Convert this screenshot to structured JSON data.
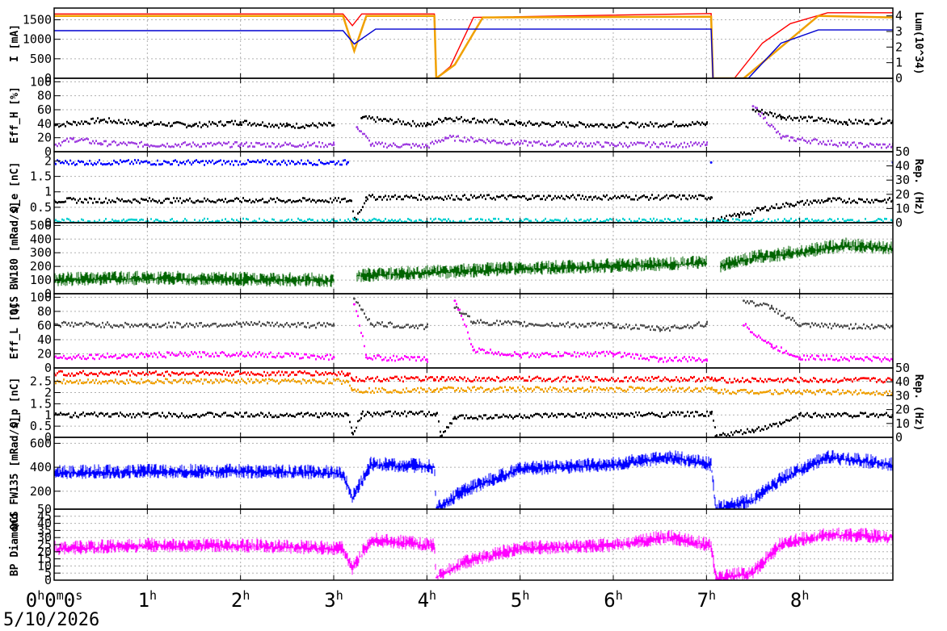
{
  "date": "5/10/2026",
  "x_axis": {
    "ticks": [
      0,
      1,
      2,
      3,
      4,
      5,
      6,
      7,
      8
    ],
    "labels": [
      {
        "h": "0",
        "s1": "h",
        "m": "0",
        "s2": "m",
        "s": "0",
        "s3": "s"
      },
      {
        "h": "1",
        "s1": "h"
      },
      {
        "h": "2",
        "s1": "h"
      },
      {
        "h": "3",
        "s1": "h"
      },
      {
        "h": "4",
        "s1": "h"
      },
      {
        "h": "5",
        "s1": "h"
      },
      {
        "h": "6",
        "s1": "h"
      },
      {
        "h": "7",
        "s1": "h"
      },
      {
        "h": "8",
        "s1": "h"
      }
    ],
    "range": [
      0,
      9
    ]
  },
  "chart_data": [
    {
      "type": "line",
      "ylabel": "I [mA]",
      "ylim": [
        0,
        1800
      ],
      "yticks": [
        0,
        500,
        1000,
        1500
      ],
      "y2label": "Lum(10^34)",
      "y2lim": [
        0,
        4.5
      ],
      "y2ticks": [
        0,
        1,
        2,
        3,
        4
      ],
      "grid": true,
      "series": [
        {
          "color": "#ff0000",
          "x": [
            0,
            3.1,
            3.2,
            3.3,
            4.08,
            4.1,
            4.25,
            4.5,
            7.05,
            7.07,
            7.3,
            7.6,
            7.9,
            8.3,
            9
          ],
          "y": [
            1650,
            1650,
            1350,
            1650,
            1650,
            0,
            300,
            1560,
            1660,
            0,
            0,
            900,
            1400,
            1680,
            1680
          ]
        },
        {
          "color": "#f0a000",
          "x": [
            0,
            3.1,
            3.22,
            3.35,
            4.08,
            4.1,
            4.3,
            4.6,
            7.05,
            7.07,
            7.4,
            7.8,
            8.2,
            9
          ],
          "y": [
            1600,
            1600,
            700,
            1600,
            1600,
            0,
            350,
            1560,
            1580,
            0,
            0,
            800,
            1600,
            1560
          ]
        },
        {
          "color": "#0000d0",
          "x": [
            0,
            3.1,
            3.22,
            3.45,
            7.05,
            7.07,
            7.45,
            7.8,
            8.2,
            9
          ],
          "y": [
            1220,
            1220,
            880,
            1260,
            1260,
            0,
            0,
            900,
            1240,
            1240
          ]
        }
      ]
    },
    {
      "type": "scatter",
      "ylabel": "Eff_H [%]",
      "ylim": [
        0,
        105
      ],
      "yticks": [
        0,
        20,
        40,
        60,
        80,
        100
      ],
      "grid": true,
      "series": [
        {
          "color": "#000000",
          "x": [
            0,
            0.5,
            1,
            1.5,
            2,
            2.5,
            3,
            3.2,
            3.3,
            4,
            4.2,
            5,
            6,
            7,
            7.2,
            7.5,
            7.8,
            8.5,
            9
          ],
          "y": [
            38,
            45,
            40,
            38,
            42,
            37,
            38,
            null,
            48,
            38,
            48,
            40,
            38,
            40,
            null,
            60,
            50,
            42,
            44
          ]
        },
        {
          "color": "#a040e0",
          "x": [
            0,
            0.2,
            0.5,
            1,
            2,
            3,
            3.2,
            3.25,
            3.4,
            4,
            4.2,
            5,
            6,
            7,
            7.2,
            7.5,
            7.8,
            8.5,
            9
          ],
          "y": [
            10,
            18,
            12,
            10,
            10,
            10,
            null,
            35,
            10,
            8,
            20,
            12,
            10,
            10,
            null,
            65,
            20,
            10,
            8
          ]
        }
      ]
    },
    {
      "type": "scatter",
      "ylabel": "Q_e [nC]",
      "ylim": [
        0,
        2.3
      ],
      "yticks": [
        0,
        0.5,
        1,
        1.5,
        2
      ],
      "y2label": "Rep. (Hz)",
      "y2lim": [
        0,
        50
      ],
      "y2ticks": [
        0,
        10,
        20,
        30,
        40,
        50
      ],
      "grid": true,
      "series": [
        {
          "color": "#0000ff",
          "x": [
            0,
            3.15,
            3.2,
            7.05,
            7.1,
            9
          ],
          "y": [
            1.95,
            1.95,
            null,
            1.95,
            null,
            1.95
          ]
        },
        {
          "color": "#000000",
          "x": [
            0,
            3.18,
            3.22,
            3.35,
            7.05,
            7.07,
            7.35,
            7.6,
            7.9,
            8.3,
            9
          ],
          "y": [
            0.72,
            0.72,
            0.1,
            0.82,
            0.82,
            0.05,
            0.25,
            0.45,
            0.6,
            0.72,
            0.72
          ]
        },
        {
          "color": "#00d0d0",
          "x": [
            0,
            9
          ],
          "y": [
            0.05,
            0.05
          ]
        }
      ]
    },
    {
      "type": "area",
      "ylabel": "QCS BW180 [mRad/s]",
      "ylim": [
        0,
        520
      ],
      "yticks": [
        0,
        100,
        200,
        300,
        400,
        500
      ],
      "grid": true,
      "series": [
        {
          "color": "#006400",
          "x": [
            0,
            1,
            2,
            3,
            3.15,
            3.25,
            4,
            5,
            6,
            7,
            7.05,
            7.15,
            7.5,
            8,
            8.5,
            9
          ],
          "y": [
            100,
            110,
            100,
            95,
            null,
            130,
            150,
            180,
            200,
            220,
            null,
            200,
            260,
            300,
            350,
            330
          ]
        }
      ]
    },
    {
      "type": "scatter",
      "ylabel": "Eff_L [%]",
      "ylim": [
        0,
        105
      ],
      "yticks": [
        0,
        20,
        40,
        60,
        80,
        100
      ],
      "grid": true,
      "series": [
        {
          "color": "#505050",
          "x": [
            0,
            1,
            2,
            3,
            3.15,
            3.22,
            3.4,
            4,
            4.2,
            4.3,
            4.5,
            5,
            6,
            6.5,
            7,
            7.15,
            7.4,
            7.7,
            8,
            9
          ],
          "y": [
            62,
            60,
            62,
            60,
            null,
            98,
            62,
            58,
            null,
            85,
            65,
            62,
            60,
            55,
            62,
            null,
            95,
            85,
            60,
            58
          ]
        },
        {
          "color": "#ff00ff",
          "x": [
            0,
            1,
            2,
            3,
            3.15,
            3.22,
            3.35,
            4,
            4.2,
            4.3,
            4.5,
            5,
            6,
            6.5,
            7,
            7.15,
            7.4,
            7.7,
            8,
            9
          ],
          "y": [
            15,
            18,
            20,
            15,
            null,
            90,
            15,
            12,
            null,
            95,
            25,
            18,
            20,
            12,
            12,
            null,
            60,
            30,
            15,
            12
          ]
        }
      ]
    },
    {
      "type": "scatter",
      "ylabel": "Q_p [nC]",
      "ylim": [
        0,
        3.1
      ],
      "yticks": [
        0,
        0.5,
        1,
        1.5,
        2,
        2.5
      ],
      "y2label": "Rep. (Hz)",
      "y2lim": [
        0,
        50
      ],
      "y2ticks": [
        0,
        10,
        20,
        30,
        40,
        50
      ],
      "grid": true,
      "series": [
        {
          "color": "#ff0000",
          "x": [
            0,
            3.15,
            3.2,
            4.08,
            4.15,
            7.05,
            7.1,
            9
          ],
          "y": [
            2.85,
            2.85,
            2.6,
            2.6,
            2.6,
            2.6,
            2.55,
            2.55
          ]
        },
        {
          "color": "#f0a000",
          "x": [
            0,
            3.15,
            3.2,
            4.08,
            4.15,
            7.05,
            7.1,
            9
          ],
          "y": [
            2.5,
            2.5,
            2.1,
            2.1,
            2.15,
            2.15,
            2.05,
            2.0
          ]
        },
        {
          "color": "#000000",
          "x": [
            0,
            3.15,
            3.2,
            3.3,
            4.1,
            4.15,
            4.3,
            7.05,
            7.1,
            7.5,
            7.8,
            8.0,
            9
          ],
          "y": [
            1.0,
            1.0,
            0.2,
            1.05,
            1.05,
            0.05,
            0.9,
            1.05,
            0.05,
            0.3,
            0.6,
            1.0,
            1.0
          ]
        }
      ]
    },
    {
      "type": "area",
      "ylabel": "QCS FW135 [mRad/s]",
      "ylim": [
        50,
        650
      ],
      "yticks": [
        50,
        200,
        400,
        600
      ],
      "grid": true,
      "series": [
        {
          "color": "#0000ff",
          "x": [
            0,
            1,
            2,
            3,
            3.1,
            3.2,
            3.4,
            4.08,
            4.1,
            4.4,
            5,
            6,
            6.6,
            7.05,
            7.1,
            7.5,
            7.8,
            8.3,
            9
          ],
          "y": [
            350,
            360,
            360,
            350,
            340,
            140,
            420,
            400,
            50,
            200,
            380,
            420,
            480,
            420,
            50,
            120,
            300,
            480,
            420
          ]
        }
      ]
    },
    {
      "type": "area",
      "ylabel": "BP Diamond",
      "ylim": [
        0,
        50
      ],
      "yticks": [
        0,
        5,
        10,
        15,
        20,
        25,
        30,
        35,
        40,
        45
      ],
      "grid": true,
      "series": [
        {
          "color": "#ff00ff",
          "x": [
            0,
            1,
            2,
            3,
            3.1,
            3.2,
            3.4,
            4.08,
            4.1,
            4.4,
            5,
            6,
            6.6,
            7.05,
            7.1,
            7.5,
            7.8,
            8.3,
            9
          ],
          "y": [
            22,
            24,
            24,
            22,
            22,
            8,
            28,
            24,
            2,
            12,
            22,
            24,
            30,
            24,
            1,
            5,
            25,
            32,
            30
          ]
        }
      ]
    }
  ]
}
